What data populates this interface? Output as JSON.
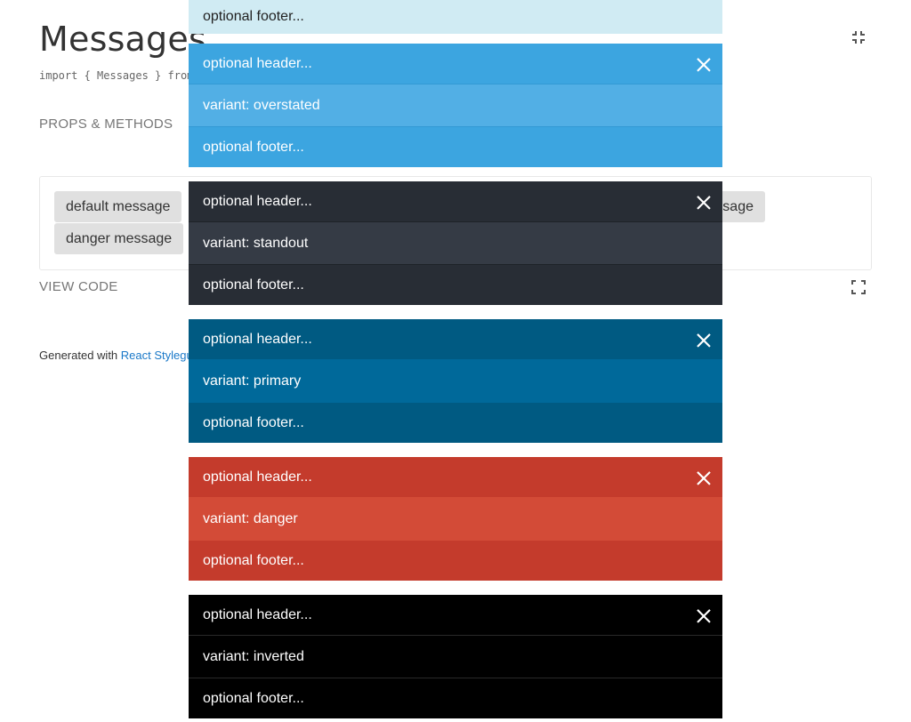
{
  "page": {
    "title": "Messages",
    "import_line": "import { Messages } from",
    "props_link": "PROPS & METHODS",
    "view_code": "VIEW CODE",
    "generated_prefix": "Generated with ",
    "generated_link": "React Stylegu"
  },
  "example": {
    "buttons": {
      "default": "default message",
      "danger": "danger message",
      "right_partial": "sage"
    }
  },
  "icons": {
    "collapse": "collapse-icon",
    "fullscreen": "fullscreen-icon",
    "close": "close-icon"
  },
  "top_partial_message": {
    "footer": "optional footer...",
    "color": "#d0ebf3"
  },
  "messages": [
    {
      "variant": "overstated",
      "header": "optional header...",
      "body": "variant: overstated",
      "footer": "optional footer...",
      "header_color": "#3ca5e0",
      "body_color": "#52afe5"
    },
    {
      "variant": "standout",
      "header": "optional header...",
      "body": "variant: standout",
      "footer": "optional footer...",
      "header_color": "#282d35",
      "body_color": "#353b45"
    },
    {
      "variant": "primary",
      "header": "optional header...",
      "body": "variant: primary",
      "footer": "optional footer...",
      "header_color": "#005a82",
      "body_color": "#00699a"
    },
    {
      "variant": "danger",
      "header": "optional header...",
      "body": "variant: danger",
      "footer": "optional footer...",
      "header_color": "#c43b2c",
      "body_color": "#d34b37"
    },
    {
      "variant": "inverted",
      "header": "optional header...",
      "body": "variant: inverted",
      "footer": "optional footer...",
      "header_color": "#000000",
      "body_color": "#000000"
    }
  ]
}
